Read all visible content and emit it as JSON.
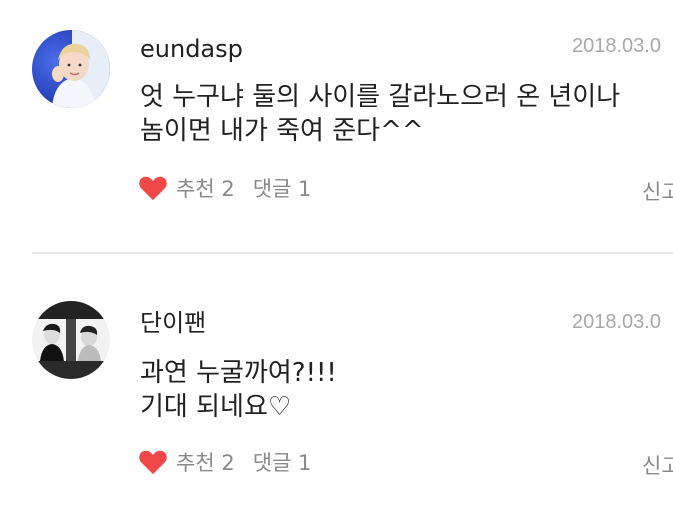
{
  "comments": [
    {
      "username": "eundasp",
      "date": "2018.03.0",
      "lines": [
        "엇 누구냐 둘의 사이를 갈라노으러 온 년이나",
        "놈이면 내가 죽여 준다^^"
      ],
      "likes_label": "추천 2",
      "replies_label": "댓글 1",
      "report_label": "신고",
      "avatar_icon": "user-photo-blue-icon"
    },
    {
      "username": "단이팬",
      "date": "2018.03.0",
      "lines": [
        "과연 누굴까여?!!!",
        "기대 되네요♡"
      ],
      "likes_label": "추천 2",
      "replies_label": "댓글 1",
      "report_label": "신고",
      "avatar_icon": "user-photo-bw-icon"
    }
  ],
  "colors": {
    "heart": "#f04848",
    "meta_gray": "#8a8a8a",
    "date_gray": "#a8a8a8",
    "divider": "#e6e6e6"
  }
}
